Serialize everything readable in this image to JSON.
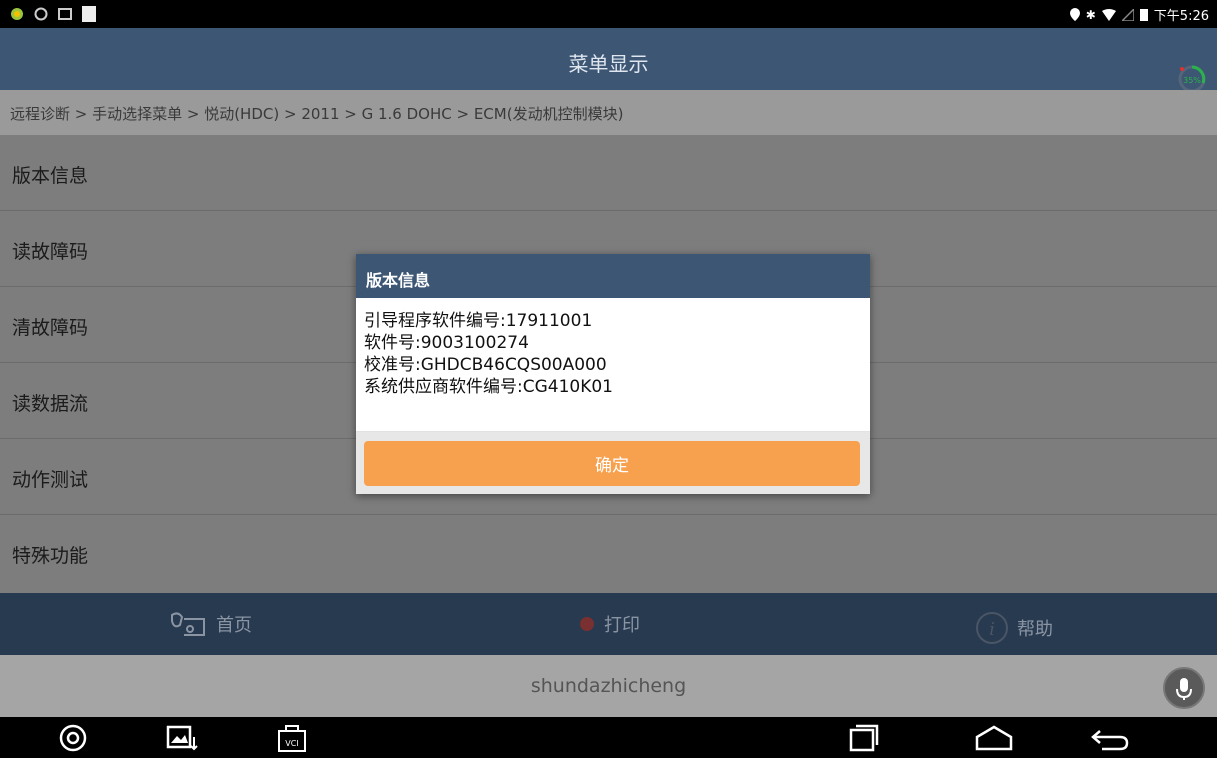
{
  "status_bar": {
    "time": "下午5:26"
  },
  "header": {
    "title": "菜单显示",
    "progress_label": "35%"
  },
  "breadcrumb": "远程诊断 > 手动选择菜单 > 悦动(HDC) > 2011 > G 1.6 DOHC > ECM(发动机控制模块)",
  "menu": {
    "items": [
      {
        "label": "版本信息"
      },
      {
        "label": "读故障码"
      },
      {
        "label": "清故障码"
      },
      {
        "label": "读数据流"
      },
      {
        "label": "动作测试"
      },
      {
        "label": "特殊功能"
      }
    ]
  },
  "toolbar": {
    "home": "首页",
    "print": "打印",
    "help": "帮助"
  },
  "footer": {
    "text": "shundazhicheng"
  },
  "dialog": {
    "title": "版本信息",
    "lines": [
      "引导程序软件编号:17911001",
      "软件号:9003100274",
      "校准号:GHDCB46CQS00A000",
      "系统供应商软件编号:CG410K01"
    ],
    "ok_label": "确定"
  },
  "navbar": {
    "vci_label": "VCI"
  },
  "colors": {
    "header": "#3d5673",
    "toolbar": "#283a50",
    "ok_button": "#f7a04d",
    "progress_ring": "#2bb24c"
  }
}
